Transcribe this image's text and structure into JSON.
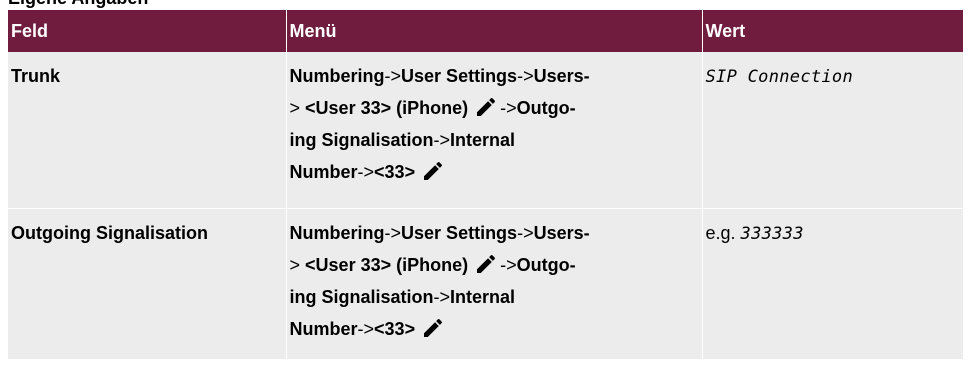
{
  "heading": "Eigene Angaben",
  "table": {
    "headers": [
      "Feld",
      "Menü",
      "Wert"
    ],
    "rows": [
      {
        "field": "Trunk",
        "menu": {
          "p1": "Numbering",
          "sep1": "->",
          "p2": "User Settings",
          "sep2": "->",
          "p3": "Users-",
          "sep3": ">",
          "p4": "<User 33> (iPhone)",
          "sep4": "->",
          "p5": "Outgo-",
          "p6": "ing Signalisation",
          "sep5": "->",
          "p7": "Internal",
          "p8": "Number",
          "sep6": "->",
          "p9": "<33>"
        },
        "value_prefix": "",
        "value": "SIP Connection"
      },
      {
        "field": "Outgoing Signalisation",
        "menu": {
          "p1": "Numbering",
          "sep1": "->",
          "p2": "User Settings",
          "sep2": "->",
          "p3": "Users-",
          "sep3": ">",
          "p4": "<User 33> (iPhone)",
          "sep4": "->",
          "p5": "Outgo-",
          "p6": "ing Signalisation",
          "sep5": "->",
          "p7": "Internal",
          "p8": "Number",
          "sep6": "->",
          "p9": "<33>"
        },
        "value_prefix": "e.g.",
        "value": "333333"
      }
    ]
  },
  "icons": {
    "edit": "pencil-icon"
  }
}
